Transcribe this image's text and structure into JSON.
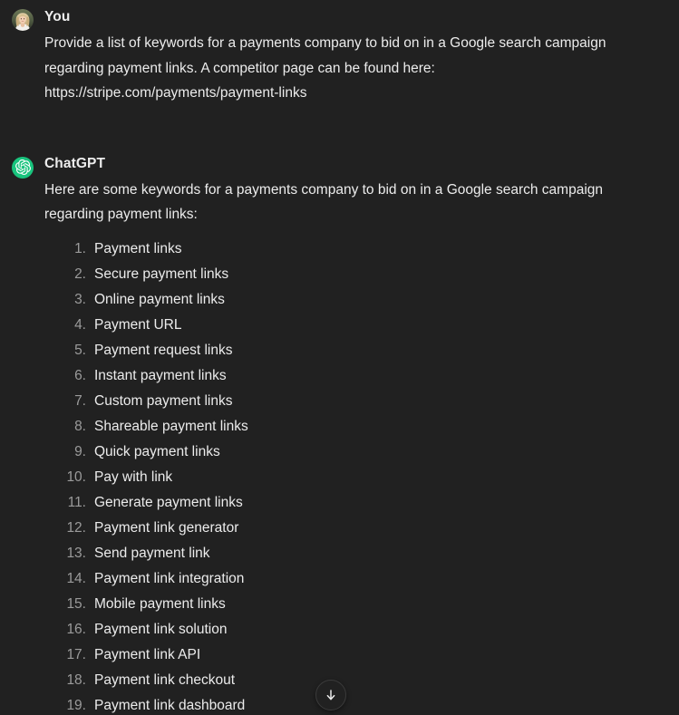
{
  "theme": {
    "background": "#212121",
    "text_primary": "#ececec",
    "text_muted": "#9b9b9b",
    "accent_green": "#19c37d",
    "button_border": "#3b3b3b"
  },
  "conversation": {
    "messages": [
      {
        "role_label": "You",
        "avatar_icon": "user-photo-avatar",
        "body": "Provide a list of keywords for a payments company to bid on in a Google search campaign regarding payment links. A competitor page can be found here:\nhttps://stripe.com/payments/payment-links"
      },
      {
        "role_label": "ChatGPT",
        "avatar_icon": "openai-logo-icon",
        "body": "Here are some keywords for a payments company to bid on in a Google search campaign regarding payment links:",
        "keywords": [
          {
            "number": "1.",
            "text": "Payment links"
          },
          {
            "number": "2.",
            "text": "Secure payment links"
          },
          {
            "number": "3.",
            "text": "Online payment links"
          },
          {
            "number": "4.",
            "text": "Payment URL"
          },
          {
            "number": "5.",
            "text": "Payment request links"
          },
          {
            "number": "6.",
            "text": "Instant payment links"
          },
          {
            "number": "7.",
            "text": "Custom payment links"
          },
          {
            "number": "8.",
            "text": "Shareable payment links"
          },
          {
            "number": "9.",
            "text": "Quick payment links"
          },
          {
            "number": "10.",
            "text": "Pay with link"
          },
          {
            "number": "11.",
            "text": "Generate payment links"
          },
          {
            "number": "12.",
            "text": "Payment link generator"
          },
          {
            "number": "13.",
            "text": "Send payment link"
          },
          {
            "number": "14.",
            "text": "Payment link integration"
          },
          {
            "number": "15.",
            "text": "Mobile payment links"
          },
          {
            "number": "16.",
            "text": "Payment link solution"
          },
          {
            "number": "17.",
            "text": "Payment link API"
          },
          {
            "number": "18.",
            "text": "Payment link checkout"
          },
          {
            "number": "19.",
            "text": "Payment link dashboard"
          }
        ]
      }
    ]
  },
  "scroll_button": {
    "icon": "arrow-down-icon",
    "label": "Scroll to bottom"
  }
}
